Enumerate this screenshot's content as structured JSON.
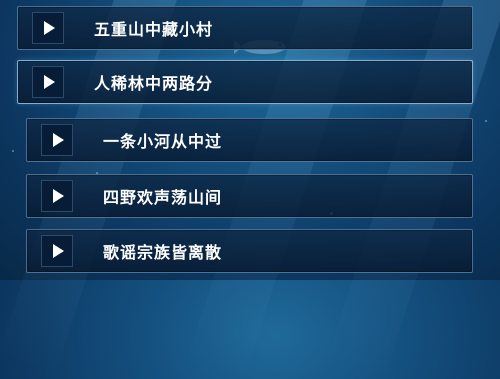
{
  "menu": {
    "items": [
      {
        "label": "五重山中藏小村",
        "icon": "play-icon"
      },
      {
        "label": "人稀林中两路分",
        "icon": "play-icon"
      },
      {
        "label": "一条小河从中过",
        "icon": "play-icon"
      },
      {
        "label": "四野欢声荡山间",
        "icon": "play-icon"
      },
      {
        "label": "歌谣宗族皆离散",
        "icon": "play-icon"
      }
    ]
  },
  "colors": {
    "background": "#144f7e",
    "item_background": "#0e2846",
    "text": "#ffffff"
  }
}
